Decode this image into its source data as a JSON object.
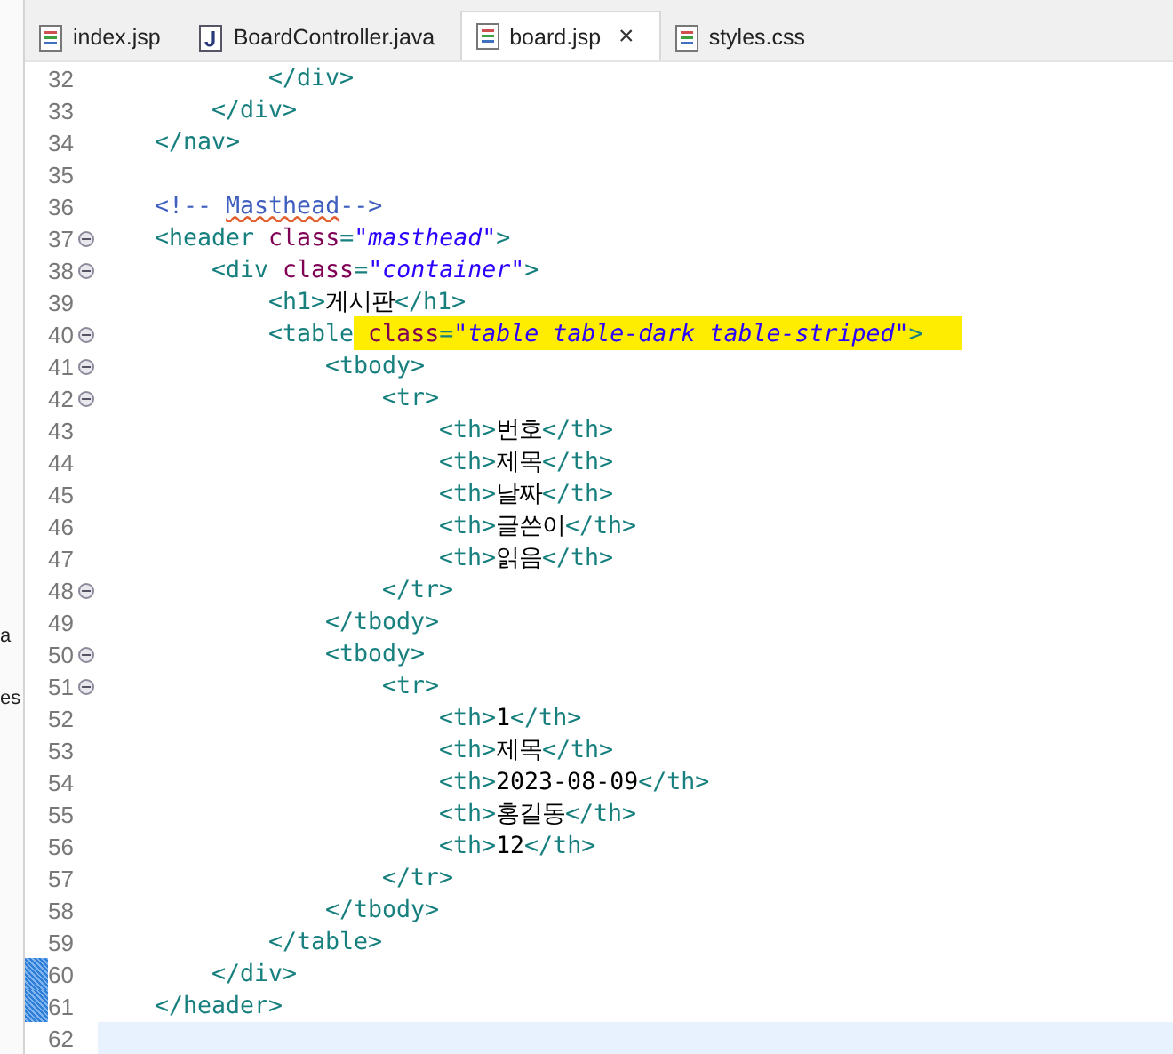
{
  "left_panel": {
    "texts": [
      "a",
      "es"
    ]
  },
  "tabs": [
    {
      "label": "index.jsp",
      "kind": "page",
      "selected": false,
      "closable": false
    },
    {
      "label": "BoardController.java",
      "kind": "java",
      "selected": false,
      "closable": false
    },
    {
      "label": "board.jsp",
      "kind": "page",
      "selected": true,
      "closable": true,
      "close_label": "×"
    },
    {
      "label": "styles.css",
      "kind": "page",
      "selected": false,
      "closable": false
    }
  ],
  "editor": {
    "lines": [
      {
        "children": [
          {
            "children": [
              {
                "number": "32",
                "foldable": false,
                "changed": false,
                "current": false,
                "tokens": [
                  {
                    "kind": "tag",
                    "text": "</div>"
                  }
                ]
              }
            ]
          },
          {
            "number": "33",
            "foldable": false,
            "changed": false,
            "current": false,
            "tokens": [
              {
                "kind": "tag",
                "text": "</div>"
              }
            ]
          }
        ]
      },
      {
        "number": "34",
        "foldable": false,
        "changed": false,
        "current": false,
        "tokens": [
          {
            "kind": "tag",
            "text": "</nav>"
          }
        ]
      },
      {
        "number": "35",
        "foldable": false,
        "changed": false,
        "current": false
      },
      {
        "number": "36",
        "foldable": false,
        "changed": false,
        "current": false,
        "tokens": [
          {
            "kind": "comment",
            "text": "<!-- "
          },
          {
            "kind": "comment",
            "text": "Masthead",
            "misspelled": true
          },
          {
            "kind": "comment",
            "text": "-->"
          }
        ]
      },
      {
        "number": "37",
        "foldable": true,
        "changed": false,
        "current": false,
        "tokens": [
          {
            "kind": "tag",
            "text": "<header "
          },
          {
            "kind": "attr",
            "text": "class"
          },
          {
            "kind": "tag",
            "text": "="
          },
          {
            "kind": "value",
            "text": "\"masthead\""
          },
          {
            "kind": "tag",
            "text": ">"
          }
        ],
        "children": [
          {
            "number": "38",
            "foldable": true,
            "changed": false,
            "current": false,
            "tokens": [
              {
                "kind": "tag",
                "text": "<div "
              },
              {
                "kind": "attr",
                "text": "class"
              },
              {
                "kind": "tag",
                "text": "="
              },
              {
                "kind": "value",
                "text": "\"container\""
              },
              {
                "kind": "tag",
                "text": ">"
              }
            ],
            "children": [
              {
                "number": "39",
                "foldable": false,
                "changed": false,
                "current": false,
                "tokens": [
                  {
                    "kind": "tag",
                    "text": "<h1>"
                  },
                  {
                    "kind": "text",
                    "text": "게시판"
                  },
                  {
                    "kind": "tag",
                    "text": "</h1>"
                  }
                ]
              },
              {
                "number": "40",
                "foldable": true,
                "changed": false,
                "current": false,
                "tokens": [
                  {
                    "kind": "tag",
                    "text": "<table"
                  },
                  {
                    "kind": "attr",
                    "text": "class",
                    "highlighted": true
                  },
                  {
                    "kind": "tag",
                    "text": "=",
                    "highlighted": true
                  },
                  {
                    "kind": "value",
                    "text": "\"table table-dark table-striped\"",
                    "highlighted": true
                  },
                  {
                    "kind": "tag",
                    "text": ">",
                    "highlighted": true
                  }
                ],
                "children": [
                  {
                    "number": "41",
                    "foldable": true,
                    "changed": false,
                    "current": false,
                    "tokens": [
                      {
                        "kind": "tag",
                        "text": "<tbody>"
                      }
                    ],
                    "children": [
                      {
                        "number": "42",
                        "foldable": true,
                        "changed": false,
                        "current": false,
                        "tokens": [
                          {
                            "kind": "tag",
                            "text": "<tr>"
                          }
                        ],
                        "children": [
                          {
                            "number": "43",
                            "foldable": false,
                            "changed": false,
                            "current": false,
                            "tokens": [
                              {
                                "kind": "tag",
                                "text": "<th>"
                              },
                              {
                                "kind": "text",
                                "text": "번호"
                              },
                              {
                                "kind": "tag",
                                "text": "</th>"
                              }
                            ]
                          },
                          {
                            "number": "44",
                            "foldable": false,
                            "changed": false,
                            "current": false,
                            "tokens": [
                              {
                                "kind": "tag",
                                "text": "<th>"
                              },
                              {
                                "kind": "text",
                                "text": "제목"
                              },
                              {
                                "kind": "tag",
                                "text": "</th>"
                              }
                            ]
                          },
                          {
                            "number": "45",
                            "foldable": false,
                            "changed": false,
                            "current": false,
                            "tokens": [
                              {
                                "kind": "tag",
                                "text": "<th>"
                              },
                              {
                                "kind": "text",
                                "text": "날짜"
                              },
                              {
                                "kind": "tag",
                                "text": "</th>"
                              }
                            ]
                          },
                          {
                            "number": "46",
                            "foldable": false,
                            "changed": false,
                            "current": false,
                            "tokens": [
                              {
                                "kind": "tag",
                                "text": "<th>"
                              },
                              {
                                "kind": "text",
                                "text": "글쓴이"
                              },
                              {
                                "kind": "tag",
                                "text": "</th>"
                              }
                            ]
                          },
                          {
                            "number": "47",
                            "foldable": false,
                            "changed": false,
                            "current": false,
                            "tokens": [
                              {
                                "kind": "tag",
                                "text": "<th>"
                              },
                              {
                                "kind": "text",
                                "text": "읽음"
                              },
                              {
                                "kind": "tag",
                                "text": "</th>"
                              }
                            ]
                          }
                        ]
                      },
                      {
                        "number": "48",
                        "foldable": true,
                        "changed": false,
                        "current": false,
                        "tokens": [
                          {
                            "kind": "tag",
                            "text": "</tr>"
                          }
                        ]
                      }
                    ]
                  },
                  {
                    "number": "49",
                    "foldable": false,
                    "changed": false,
                    "current": false,
                    "tokens": [
                      {
                        "kind": "tag",
                        "text": "</tbody>"
                      }
                    ]
                  },
                  {
                    "number": "50",
                    "foldable": true,
                    "changed": false,
                    "current": false,
                    "tokens": [
                      {
                        "kind": "tag",
                        "text": "<tbody>"
                      }
                    ],
                    "children": [
                      {
                        "number": "51",
                        "foldable": true,
                        "changed": false,
                        "current": false,
                        "tokens": [
                          {
                            "kind": "tag",
                            "text": "<tr>"
                          }
                        ],
                        "children": [
                          {
                            "number": "52",
                            "foldable": false,
                            "changed": false,
                            "current": false,
                            "tokens": [
                              {
                                "kind": "tag",
                                "text": "<th>"
                              },
                              {
                                "kind": "text",
                                "text": "1"
                              },
                              {
                                "kind": "tag",
                                "text": "</th>"
                              }
                            ]
                          },
                          {
                            "number": "53",
                            "foldable": false,
                            "changed": false,
                            "current": false,
                            "tokens": [
                              {
                                "kind": "tag",
                                "text": "<th>"
                              },
                              {
                                "kind": "text",
                                "text": "제목"
                              },
                              {
                                "kind": "tag",
                                "text": "</th>"
                              }
                            ]
                          },
                          {
                            "number": "54",
                            "foldable": false,
                            "changed": false,
                            "current": false,
                            "tokens": [
                              {
                                "kind": "tag",
                                "text": "<th>"
                              },
                              {
                                "kind": "text",
                                "text": "2023-08-09"
                              },
                              {
                                "kind": "tag",
                                "text": "</th>"
                              }
                            ]
                          },
                          {
                            "number": "55",
                            "foldable": false,
                            "changed": false,
                            "current": false,
                            "tokens": [
                              {
                                "kind": "tag",
                                "text": "<th>"
                              },
                              {
                                "kind": "text",
                                "text": "홍길동"
                              },
                              {
                                "kind": "tag",
                                "text": "</th>"
                              }
                            ]
                          },
                          {
                            "number": "56",
                            "foldable": false,
                            "changed": false,
                            "current": false,
                            "tokens": [
                              {
                                "kind": "tag",
                                "text": "<th>"
                              },
                              {
                                "kind": "text",
                                "text": "12"
                              },
                              {
                                "kind": "tag",
                                "text": "</th>"
                              }
                            ]
                          }
                        ]
                      },
                      {
                        "number": "57",
                        "foldable": false,
                        "changed": false,
                        "current": false,
                        "tokens": [
                          {
                            "kind": "tag",
                            "text": "</tr>"
                          }
                        ]
                      }
                    ]
                  },
                  {
                    "number": "58",
                    "foldable": false,
                    "changed": false,
                    "current": false,
                    "tokens": [
                      {
                        "kind": "tag",
                        "text": "</tbody>"
                      }
                    ]
                  }
                ]
              },
              {
                "number": "59",
                "foldable": false,
                "changed": false,
                "current": false,
                "tokens": [
                  {
                    "kind": "tag",
                    "text": "</table>"
                  }
                ]
              }
            ]
          },
          {
            "number": "60",
            "foldable": false,
            "changed": true,
            "current": false,
            "tokens": [
              {
                "kind": "tag",
                "text": "</div>"
              }
            ]
          }
        ]
      },
      {
        "number": "61",
        "foldable": false,
        "changed": true,
        "current": false,
        "tokens": [
          {
            "kind": "tag",
            "text": "</header>"
          }
        ]
      },
      {
        "number": "62",
        "foldable": false,
        "changed": false,
        "current": true
      }
    ]
  }
}
